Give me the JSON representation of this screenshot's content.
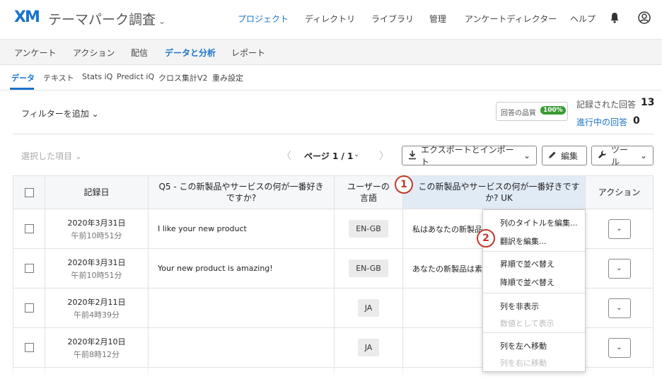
{
  "header": {
    "logo": "XM",
    "project_title": "テーマパーク調査",
    "nav": [
      "プロジェクト",
      "ディレクトリ",
      "ライブラリ",
      "管理",
      "アンケートディレクター",
      "ヘルプ"
    ]
  },
  "secondary_nav": [
    "アンケート",
    "アクション",
    "配信",
    "データと分析",
    "レポート"
  ],
  "tabs": [
    "データ",
    "テキスト",
    "Stats iQ",
    "Predict iQ",
    "クロス集計V2",
    "重み設定"
  ],
  "filter": {
    "label": "フィルターを追加"
  },
  "quality": {
    "label": "回答の品質",
    "badge": "100%"
  },
  "stats": {
    "recorded_label": "記録された回答",
    "recorded_value": "13",
    "inprogress_label": "進行中の回答",
    "inprogress_value": "0"
  },
  "toolbar": {
    "selected_items": "選択した項目",
    "page_label": "ページ 1 / 1",
    "export": "エクスポートとインポート",
    "edit": "編集",
    "tools": "ツール"
  },
  "table": {
    "headers": {
      "date": "記録日",
      "q5_line1": "Q5 - この新製品やサービスの何が一番好き",
      "q5_line2": "ですか?",
      "lang_line1": "ユーザーの",
      "lang_line2": "言語",
      "uk_line1": "この新製品やサービスの何が一番好きです",
      "uk_line2": "か? UK",
      "action": "アクション"
    },
    "rows": [
      {
        "date": "2020年3月31日",
        "time": "午前10時51分",
        "q5": "I like your new product",
        "lang": "EN-GB",
        "uk": "私はあなたの新製品"
      },
      {
        "date": "2020年3月31日",
        "time": "午前10時51分",
        "q5": "Your new product is amazing!",
        "lang": "EN-GB",
        "uk": "あなたの新製品は素晴"
      },
      {
        "date": "2020年2月11日",
        "time": "午前4時39分",
        "q5": "",
        "lang": "JA",
        "uk": ""
      },
      {
        "date": "2020年2月10日",
        "time": "午前8時12分",
        "q5": "",
        "lang": "JA",
        "uk": ""
      }
    ]
  },
  "context_menu": {
    "items": [
      "列のタイトルを編集...",
      "翻訳を編集...",
      "昇順で並べ替え",
      "降順で並べ替え",
      "列を非表示",
      "数値として表示",
      "列を左へ移動",
      "列を右に移動"
    ]
  },
  "callouts": [
    "1",
    "2"
  ]
}
